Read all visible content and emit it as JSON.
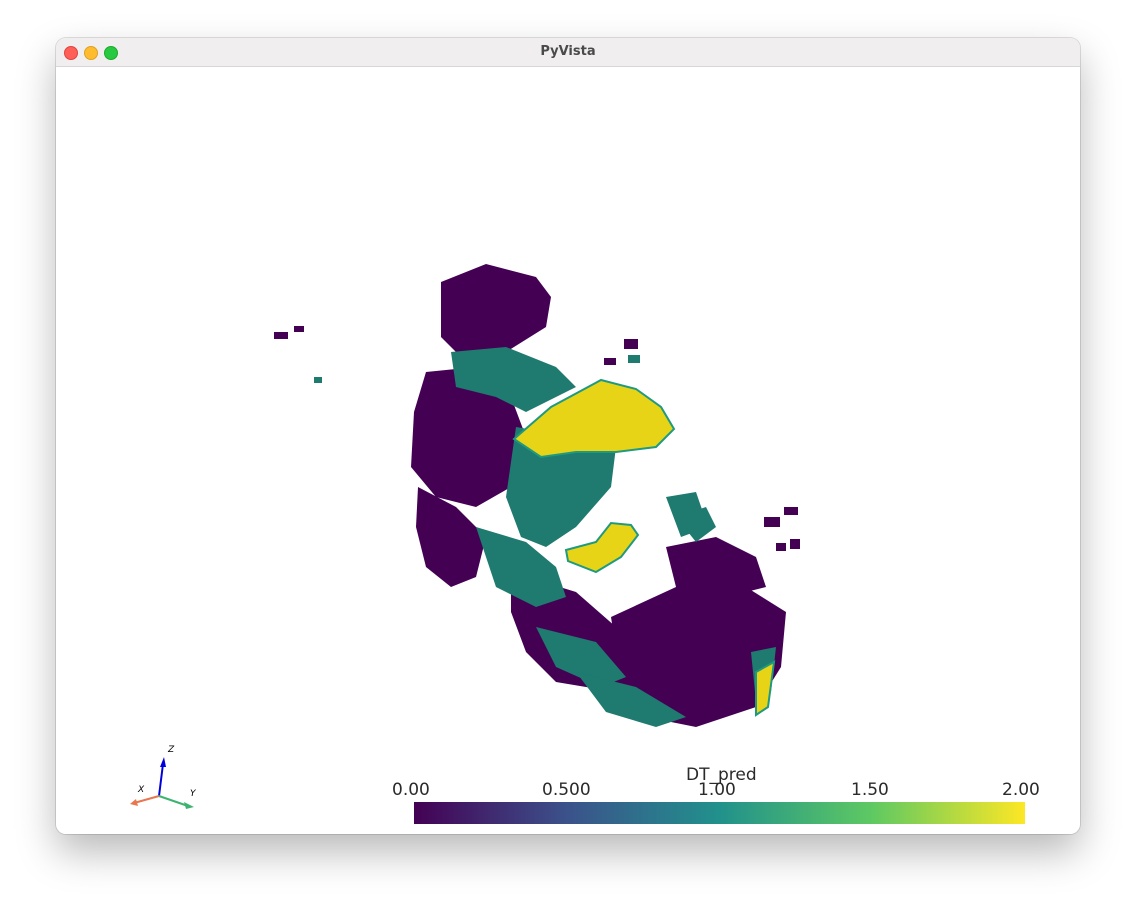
{
  "window": {
    "title": "PyVista"
  },
  "scalar_bar": {
    "title": "DT_pred",
    "ticks": [
      "0.00",
      "0.500",
      "1.00",
      "1.50",
      "2.00"
    ],
    "colormap": [
      "#440154",
      "#3b528b",
      "#21918c",
      "#5ec962",
      "#fde725"
    ]
  },
  "orientation_axes": {
    "x": "X",
    "y": "Y",
    "z": "Z"
  },
  "colors": {
    "low": "#440154",
    "mid": "#1f7a70",
    "high": "#e8d416",
    "x_axis": "#e8764e",
    "y_axis": "#3cb371",
    "z_axis": "#0000dd"
  }
}
